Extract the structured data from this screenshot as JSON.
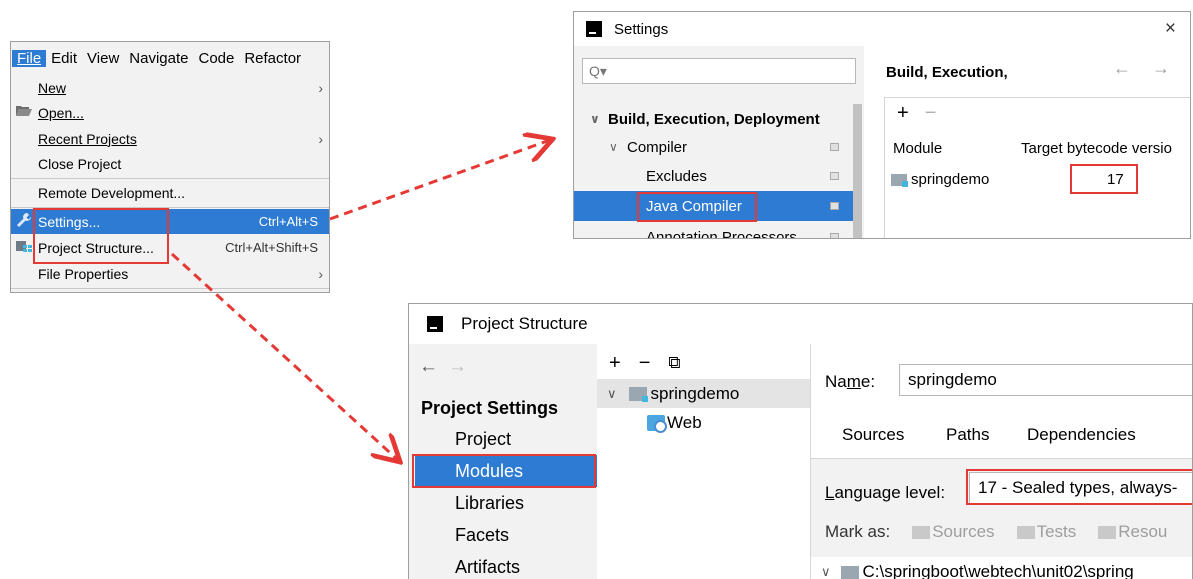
{
  "file_menu": {
    "menubar": [
      "File",
      "Edit",
      "View",
      "Navigate",
      "Code",
      "Refactor"
    ],
    "items": [
      {
        "label": "New",
        "arrow": "›"
      },
      {
        "label": "Open...",
        "icon": "folder-open-icon"
      },
      {
        "label": "Recent Projects",
        "arrow": "›"
      },
      {
        "label": "Close Project"
      },
      {
        "label": "Remote Development..."
      },
      {
        "label": "Settings...",
        "shortcut": "Ctrl+Alt+S",
        "icon": "wrench-icon",
        "selected": true
      },
      {
        "label": "Project Structure...",
        "shortcut": "Ctrl+Alt+Shift+S",
        "icon": "project-structure-icon"
      },
      {
        "label": "File Properties",
        "arrow": "›"
      }
    ]
  },
  "settings": {
    "title": "Settings",
    "close": "×",
    "search_placeholder": "Q▾",
    "tree": [
      {
        "label": "Build, Execution, Deployment",
        "chev": "∨",
        "bold": true
      },
      {
        "label": "Compiler",
        "chev": "∨"
      },
      {
        "label": "Excludes"
      },
      {
        "label": "Java Compiler",
        "selected": true
      },
      {
        "label": "Annotation Processors"
      }
    ],
    "breadcrumb": "Build, Execution, ",
    "nav": "← →",
    "toolbar": {
      "add": "+",
      "remove": "−"
    },
    "columns": [
      "Module",
      "Target bytecode versio"
    ],
    "row": {
      "module": "springdemo",
      "target": "17"
    }
  },
  "project_structure": {
    "title": "Project Structure",
    "nav": {
      "back": "←",
      "forward": "→"
    },
    "heading": "Project Settings",
    "items": [
      {
        "label": "Project"
      },
      {
        "label": "Modules",
        "selected": true
      },
      {
        "label": "Libraries"
      },
      {
        "label": "Facets"
      },
      {
        "label": "Artifacts"
      }
    ],
    "toolbar": {
      "add": "+",
      "remove": "−",
      "copy": "⧉"
    },
    "tree": {
      "module": "springdemo",
      "child": "Web",
      "chev": "∨"
    },
    "name_label": "Name:",
    "name_value": "springdemo",
    "tabs": [
      "Sources",
      "Paths",
      "Dependencies"
    ],
    "language_label": "Language level:",
    "language_value": "17 - Sealed types, always-",
    "mark_as": "Mark as:",
    "marks": [
      "Sources",
      "Tests",
      "Resou"
    ],
    "root_path": "C:\\springboot\\webtech\\unit02\\spring"
  },
  "colors": {
    "selection": "#2d7bd2",
    "highlight": "#e53935",
    "panel": "#f2f2f2"
  }
}
